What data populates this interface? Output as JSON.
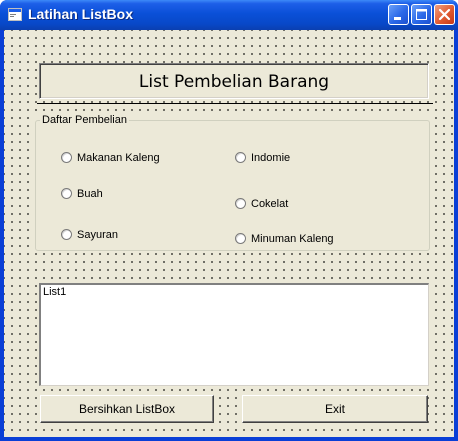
{
  "window": {
    "title": "Latihan ListBox"
  },
  "header": {
    "label": "List Pembelian Barang"
  },
  "frame": {
    "legend": "Daftar Pembelian",
    "options": [
      {
        "label": "Makanan Kaleng"
      },
      {
        "label": "Indomie"
      },
      {
        "label": "Buah"
      },
      {
        "label": "Cokelat"
      },
      {
        "label": "Sayuran"
      },
      {
        "label": "Minuman Kaleng"
      }
    ]
  },
  "listbox": {
    "items": [
      "List1"
    ]
  },
  "buttons": {
    "clear_label": "Bersihkan ListBox",
    "exit_label": "Exit"
  },
  "colors": {
    "titlebar": "#0a50d8",
    "client_bg": "#ece9d8",
    "close_button": "#e05a30"
  }
}
